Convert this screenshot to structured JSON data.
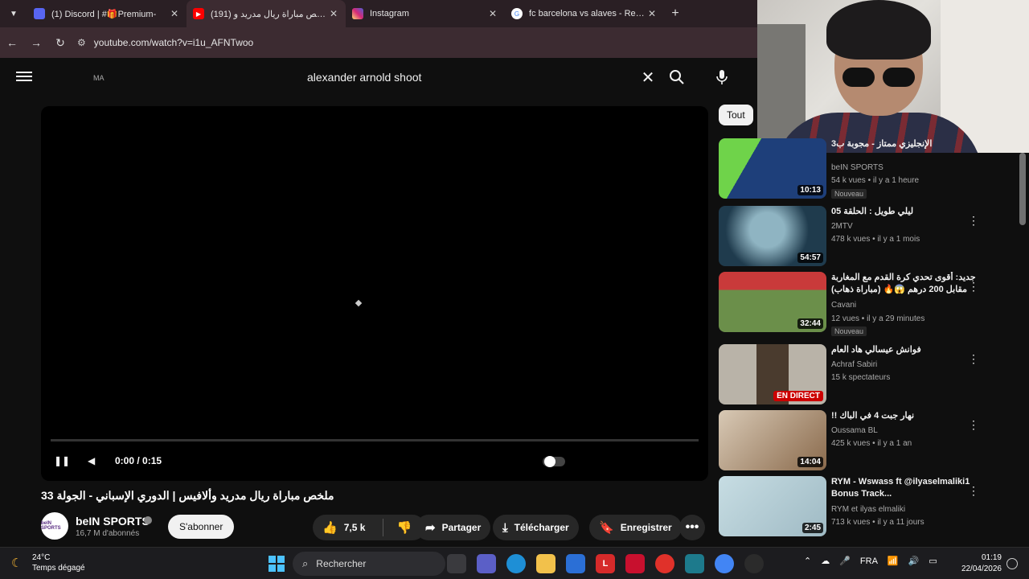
{
  "browser": {
    "tabs": [
      {
        "title": "(1) Discord | #🎁Premium-",
        "favicon_color": "#5865f2"
      },
      {
        "title": "(191) ملخص مباراة ريال مدريد و",
        "favicon_color": "#ff0000"
      },
      {
        "title": "Instagram",
        "favicon_color": "#d62976"
      },
      {
        "title": "fc barcelona vs alaves - Recher",
        "favicon_color": "#4285f4"
      }
    ],
    "new_tab": "+",
    "tab_close": "✕",
    "url": "youtube.com/watch?v=i1u_AFNTwoo"
  },
  "youtube": {
    "country": "MA",
    "search": {
      "value": "alexander arnold shoot",
      "clear": "✕"
    },
    "player": {
      "time": "0:00 / 0:15"
    },
    "video_title": "ملخص مباراة ريال مدريد وألافيس | الدوري الإسباني - الجولة 33",
    "channel": {
      "name": "beIN SPORTS",
      "subs": "16,7 M d'abonnés",
      "avatar_text": "beIN SPORTS"
    },
    "subscribe": "S'abonner",
    "likes": "7,5 k",
    "share": "Partager",
    "download": "Télécharger",
    "save": "Enregistrer",
    "more": "•••",
    "chip": "Tout",
    "recs": [
      {
        "title": "الإنجليزي ممتاز - مجوبة ب3",
        "channel": "beIN SPORTS",
        "meta": "54 k vues • il y a 1 heure",
        "badge": "Nouveau",
        "duration": "10:13",
        "thumb": "#1e3f7a",
        "thumb2": "#6fd34a"
      },
      {
        "title": "ليلي طويل : الحلقة 05",
        "channel": "2MTV",
        "meta": "478 k vues • il y a 1 mois",
        "duration": "54:57",
        "thumb": "#1f3b4d",
        "thumb2": "#8fb4c2"
      },
      {
        "title": "جديد: أقوى تحدي كرة القدم مع المغاربة مقابل 200 درهم 😱🔥 (مباراة ذهاب)",
        "channel": "Cavani",
        "meta": "12 vues • il y a 29 minutes",
        "badge": "Nouveau",
        "duration": "32:44",
        "thumb": "#6b8f4a",
        "thumb2": "#c93a3a"
      },
      {
        "title": "فوانش عيسالي هاد العام",
        "channel": "Achraf Sabiri",
        "meta": "15 k spectateurs",
        "live": "EN DIRECT",
        "thumb": "#b9b3a8",
        "thumb2": "#4a3b2e"
      },
      {
        "title": "نهار جبت 4 في الباك !!",
        "channel": "Oussama BL",
        "meta": "425 k vues • il y a 1 an",
        "duration": "14:04",
        "thumb": "#d8c9b5",
        "thumb2": "#8a6a4c"
      },
      {
        "title": "RYM - Wswass ft @ilyaselmaliki1 Bonus Track...",
        "channel": "RYM et ilyas elmaliki",
        "meta": "713 k vues • il y a 11 jours",
        "duration": "2:45",
        "thumb": "#c7dde3",
        "thumb2": "#9fbac4"
      }
    ]
  },
  "taskbar": {
    "temp": "24°C",
    "weather": "Temps dégagé",
    "search": "Rechercher",
    "lang": "FRA",
    "time": "01:19",
    "date": "22/04/2026"
  }
}
